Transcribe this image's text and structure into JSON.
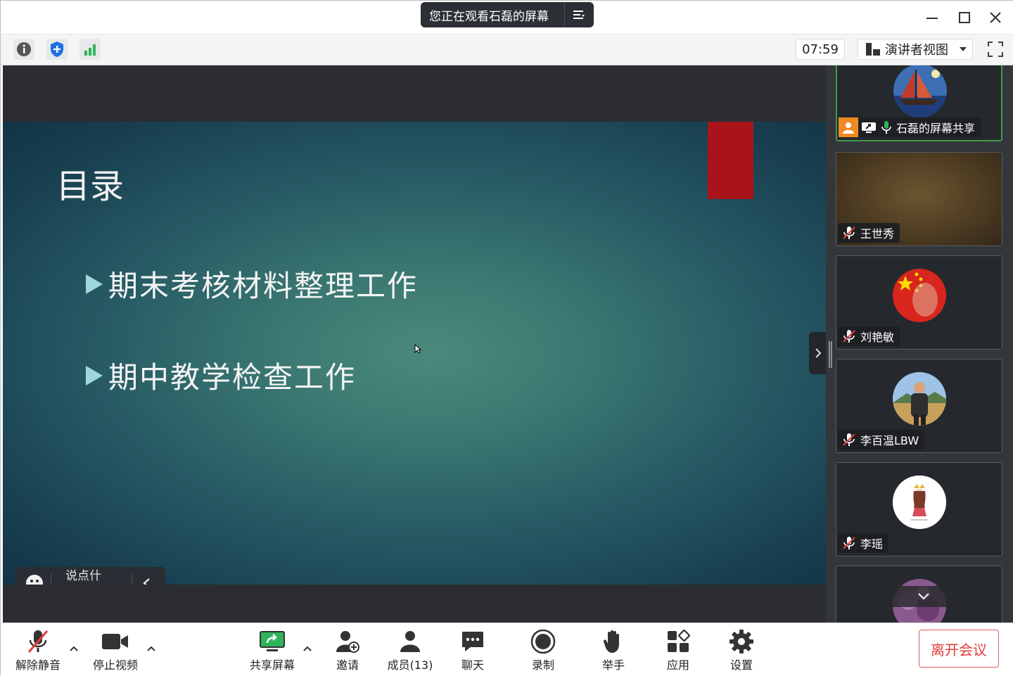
{
  "titlebar": {
    "viewing_text": "您正在观看石磊的屏幕",
    "menu_icon": "list-menu-icon"
  },
  "toolbar": {
    "timer": "07:59",
    "view_mode": "演讲者视图",
    "icons": [
      "info-icon",
      "shield-icon",
      "signal-bars-icon"
    ]
  },
  "slide": {
    "title": "目录",
    "bullets": [
      "期末考核材料整理工作",
      "期中教学检查工作"
    ]
  },
  "say_box": {
    "placeholder": "说点什么..."
  },
  "participants": [
    {
      "name": "石磊的屏幕共享",
      "muted": false,
      "sharing": true
    },
    {
      "name": "王世秀",
      "muted": true
    },
    {
      "name": "刘艳敏",
      "muted": true
    },
    {
      "name": "李百温LBW",
      "muted": true
    },
    {
      "name": "李瑶",
      "muted": true
    }
  ],
  "bottombar": {
    "unmute": "解除静音",
    "stop_video": "停止视频",
    "share_screen": "共享屏幕",
    "invite": "邀请",
    "members": "成员(13)",
    "chat": "聊天",
    "record": "录制",
    "raise_hand": "举手",
    "apps": "应用",
    "settings": "设置",
    "leave": "离开会议"
  },
  "colors": {
    "accent_green": "#2fb45a",
    "leave_red": "#e03c3c",
    "slide_red": "#a8141a",
    "active_tile_border": "#3e9b4a"
  }
}
